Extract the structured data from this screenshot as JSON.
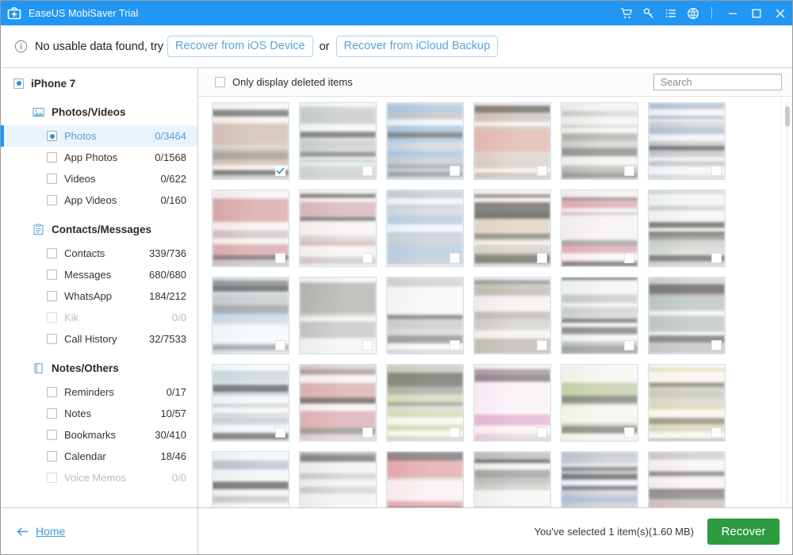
{
  "window": {
    "title": "EaseUS MobiSaver Trial",
    "app_icon": "first-aid-kit-icon",
    "accent_color": "#2196f3",
    "toolbar_icons": [
      "cart-icon",
      "key-icon",
      "list-icon",
      "globe-icon"
    ],
    "controls": [
      "minimize-button",
      "maximize-button",
      "close-button"
    ]
  },
  "notice": {
    "icon": "info-icon",
    "text": "No usable data found, try",
    "button_ios": "Recover from iOS Device",
    "or": "or",
    "button_icloud": "Recover from iCloud Backup"
  },
  "sidebar": {
    "device": {
      "label": "iPhone 7",
      "icon": "radio-selected-icon"
    },
    "groups": [
      {
        "label": "Photos/Videos",
        "icon": "photo-icon",
        "items": [
          {
            "label": "Photos",
            "count": "0/3464",
            "selected": true,
            "disabled": false,
            "control": "radio"
          },
          {
            "label": "App Photos",
            "count": "0/1568",
            "selected": false,
            "disabled": false,
            "control": "checkbox"
          },
          {
            "label": "Videos",
            "count": "0/622",
            "selected": false,
            "disabled": false,
            "control": "checkbox"
          },
          {
            "label": "App Videos",
            "count": "0/160",
            "selected": false,
            "disabled": false,
            "control": "checkbox"
          }
        ]
      },
      {
        "label": "Contacts/Messages",
        "icon": "clipboard-icon",
        "items": [
          {
            "label": "Contacts",
            "count": "339/736",
            "selected": false,
            "disabled": false,
            "control": "checkbox"
          },
          {
            "label": "Messages",
            "count": "680/680",
            "selected": false,
            "disabled": false,
            "control": "checkbox"
          },
          {
            "label": "WhatsApp",
            "count": "184/212",
            "selected": false,
            "disabled": false,
            "control": "checkbox"
          },
          {
            "label": "Kik",
            "count": "0/0",
            "selected": false,
            "disabled": true,
            "control": "checkbox"
          },
          {
            "label": "Call History",
            "count": "32/7533",
            "selected": false,
            "disabled": false,
            "control": "checkbox"
          }
        ]
      },
      {
        "label": "Notes/Others",
        "icon": "notebook-icon",
        "items": [
          {
            "label": "Reminders",
            "count": "0/17",
            "selected": false,
            "disabled": false,
            "control": "checkbox"
          },
          {
            "label": "Notes",
            "count": "10/57",
            "selected": false,
            "disabled": false,
            "control": "checkbox"
          },
          {
            "label": "Bookmarks",
            "count": "30/410",
            "selected": false,
            "disabled": false,
            "control": "checkbox"
          },
          {
            "label": "Calendar",
            "count": "18/46",
            "selected": false,
            "disabled": false,
            "control": "checkbox"
          },
          {
            "label": "Voice Memos",
            "count": "0/0",
            "selected": false,
            "disabled": true,
            "control": "checkbox"
          }
        ]
      }
    ],
    "home": {
      "label": "Home",
      "icon": "arrow-left-icon"
    }
  },
  "main": {
    "filter_checkbox_label": "Only display deleted items",
    "filter_checked": false,
    "search": {
      "value": "",
      "placeholder": "Search"
    },
    "scroll_position_percent": 2,
    "thumbnails": [
      {
        "checked": true,
        "tint": "#efebe7",
        "accent": "#b08a7a"
      },
      {
        "checked": false,
        "tint": "#eef0ef",
        "accent": "#7fa8a0"
      },
      {
        "checked": false,
        "tint": "#e9eef3",
        "accent": "#5b91c4"
      },
      {
        "checked": false,
        "tint": "#f3ece5",
        "accent": "#d0776a"
      },
      {
        "checked": false,
        "tint": "#ecebe8",
        "accent": "#6d6a63"
      },
      {
        "checked": false,
        "tint": "#edeef0",
        "accent": "#6a86a8"
      },
      {
        "checked": false,
        "tint": "#efe9e8",
        "accent": "#c05a62"
      },
      {
        "checked": false,
        "tint": "#f0eceb",
        "accent": "#b8787c"
      },
      {
        "checked": false,
        "tint": "#e9edf2",
        "accent": "#7ea4c8"
      },
      {
        "checked": false,
        "tint": "#f2eee7",
        "accent": "#cbb79a"
      },
      {
        "checked": false,
        "tint": "#efe9ea",
        "accent": "#cc5f6e"
      },
      {
        "checked": false,
        "tint": "#eceeea",
        "accent": "#86a28c"
      },
      {
        "checked": false,
        "tint": "#edf1f4",
        "accent": "#8fb6d4"
      },
      {
        "checked": false,
        "tint": "#ecebe9",
        "accent": "#74706c"
      },
      {
        "checked": false,
        "tint": "#f4f4f2",
        "accent": "#9fa5a0"
      },
      {
        "checked": false,
        "tint": "#edeae6",
        "accent": "#8b8176"
      },
      {
        "checked": false,
        "tint": "#eceeec",
        "accent": "#7f9486"
      },
      {
        "checked": false,
        "tint": "#eff0ef",
        "accent": "#82918c"
      },
      {
        "checked": false,
        "tint": "#eff2f4",
        "accent": "#9db6c6"
      },
      {
        "checked": false,
        "tint": "#f2e9e9",
        "accent": "#c06a72"
      },
      {
        "checked": false,
        "tint": "#f1f1e6",
        "accent": "#b0bc72"
      },
      {
        "checked": false,
        "tint": "#f6eaf1",
        "accent": "#e25fa8"
      },
      {
        "checked": false,
        "tint": "#eef0e6",
        "accent": "#93a861"
      },
      {
        "checked": false,
        "tint": "#f2f1e4",
        "accent": "#c2c271"
      },
      {
        "checked": false,
        "tint": "#ecedef",
        "accent": "#7d8d9e"
      },
      {
        "checked": false,
        "tint": "#eceaea",
        "accent": "#6f6b6c"
      },
      {
        "checked": false,
        "tint": "#f4e7e8",
        "accent": "#d0606c"
      },
      {
        "checked": false,
        "tint": "#ededec",
        "accent": "#7d8376"
      },
      {
        "checked": false,
        "tint": "#eceef2",
        "accent": "#5f7fad"
      },
      {
        "checked": false,
        "tint": "#f0ecec",
        "accent": "#a57f80"
      }
    ]
  },
  "footer": {
    "status": "You've selected 1 item(s)(1.60 MB)",
    "recover_label": "Recover",
    "recover_color": "#2e9b41"
  }
}
